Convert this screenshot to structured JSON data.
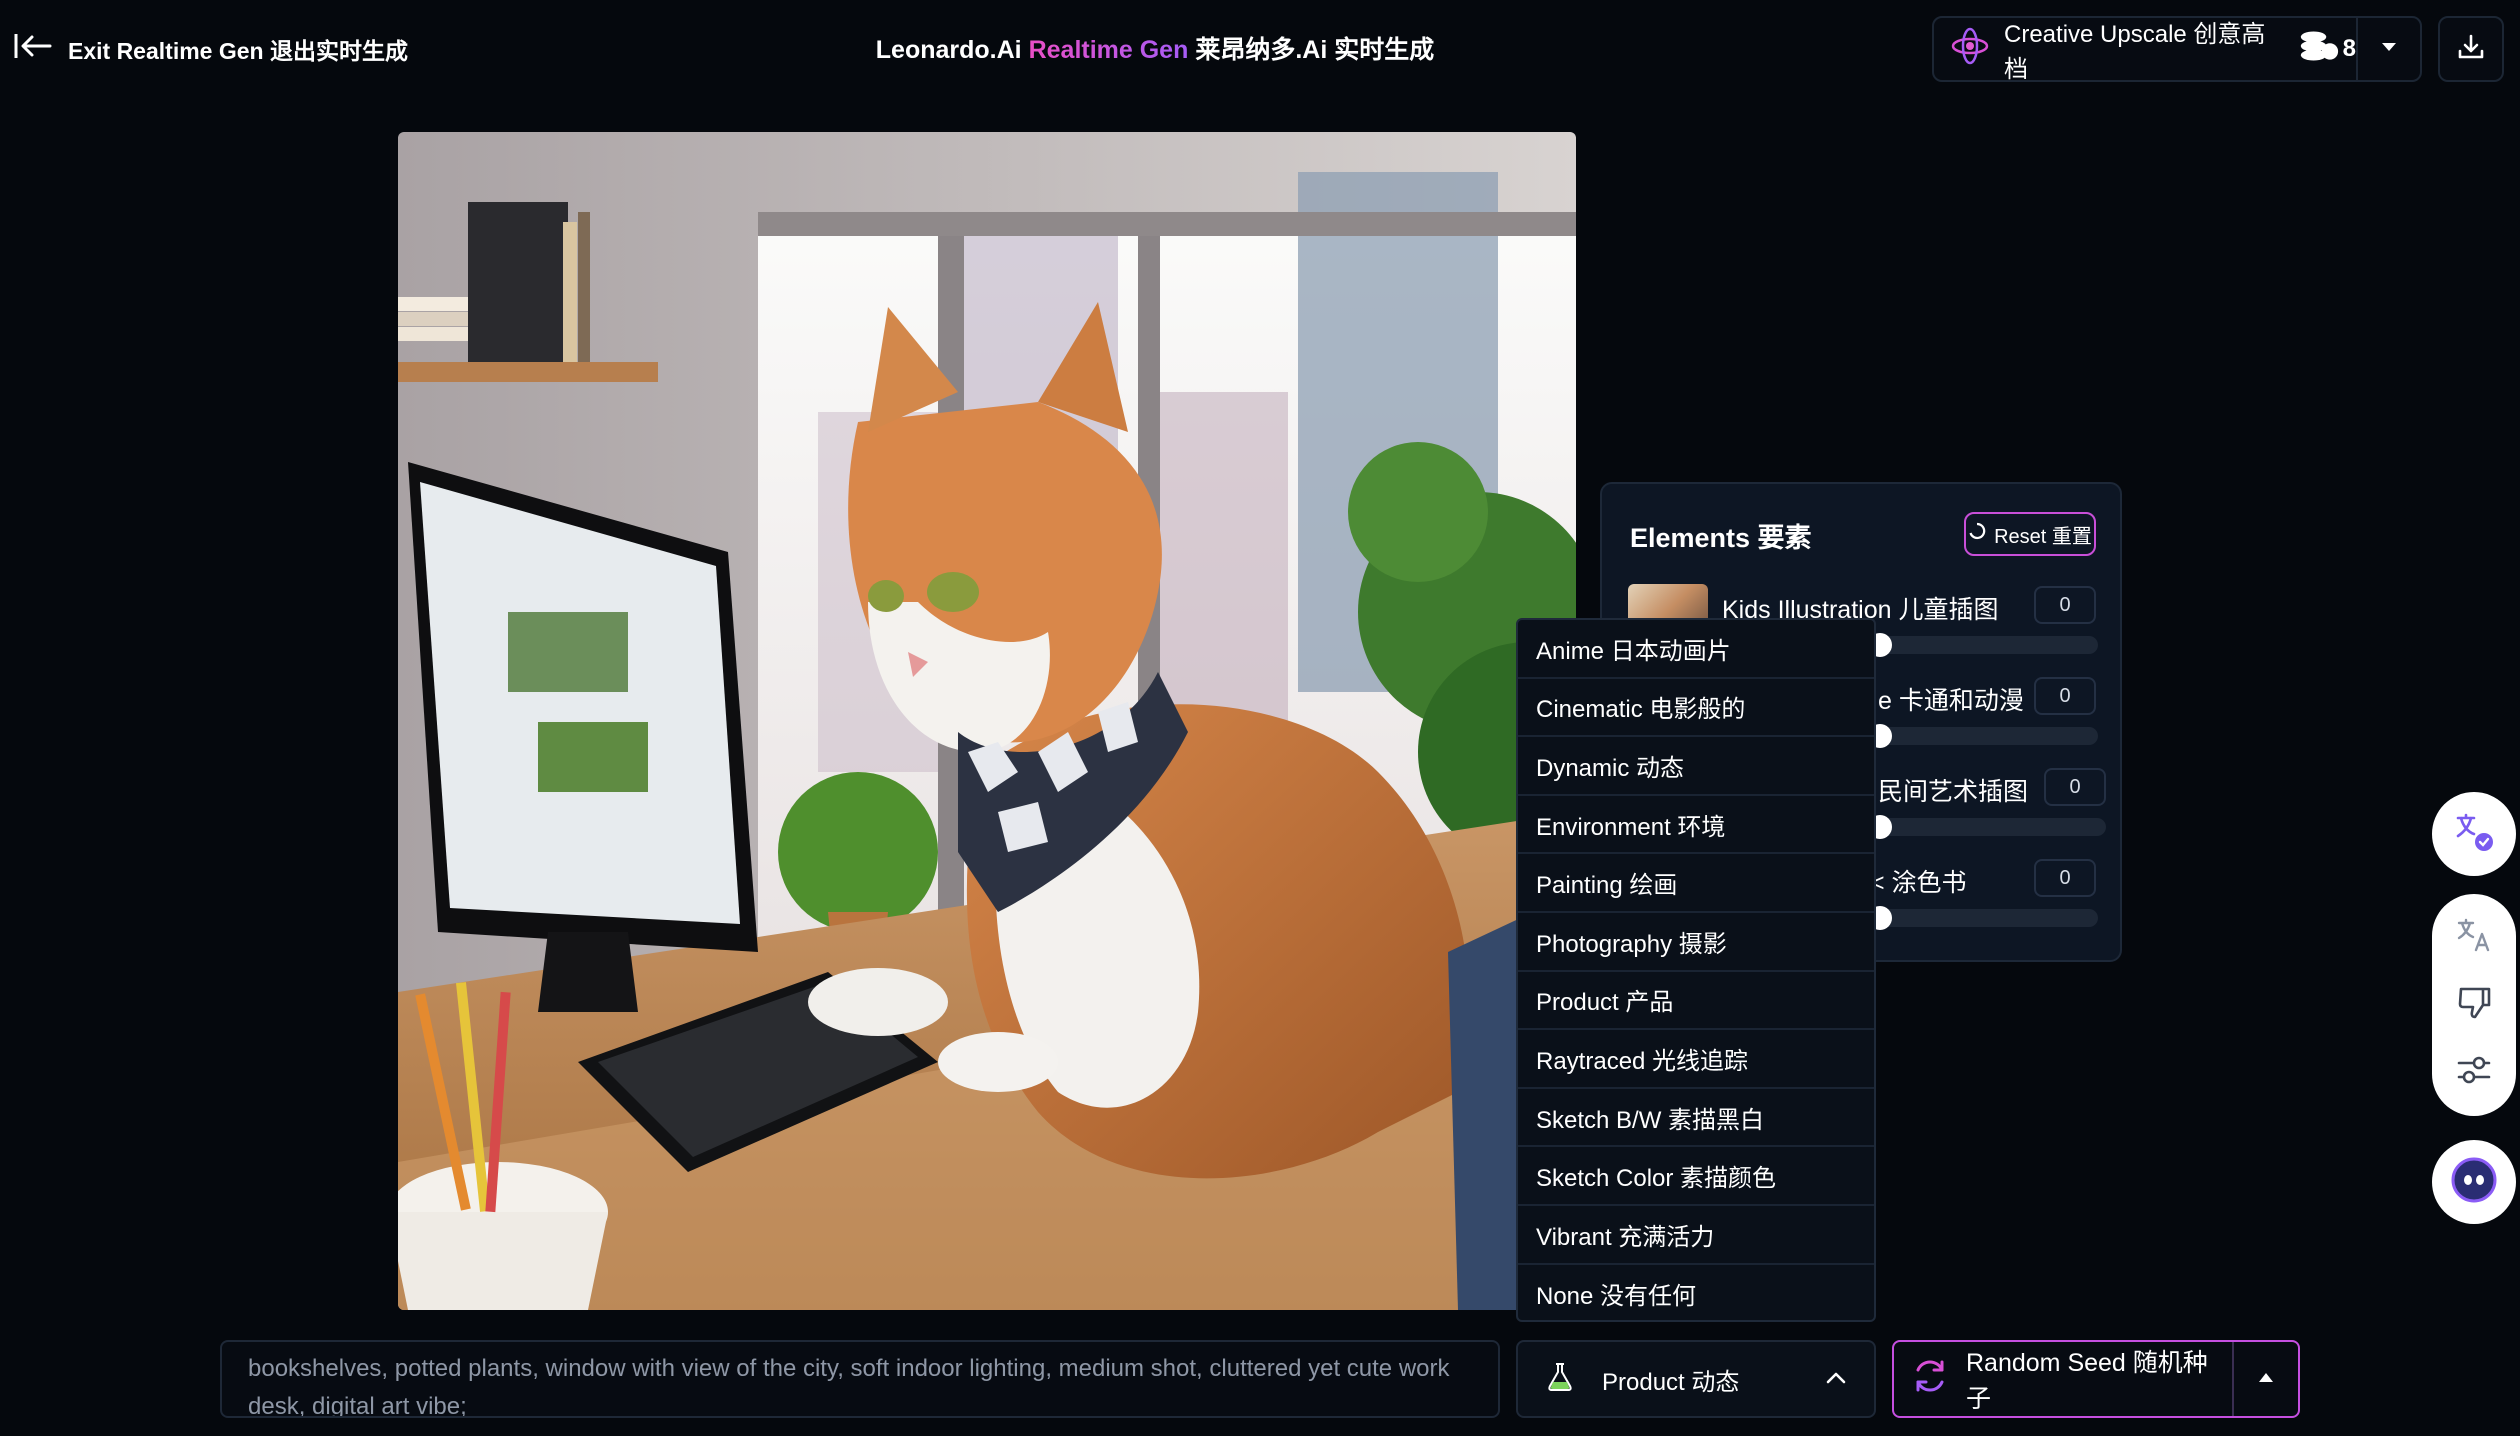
{
  "header": {
    "exit_label": "Exit Realtime Gen 退出实时生成",
    "title_brand": "Leonardo.Ai",
    "title_accent": "Realtime Gen",
    "title_cn": "莱昂纳多.Ai 实时生成",
    "upscale_label": "Creative Upscale 创意高档",
    "token_cost": "8"
  },
  "elements_panel": {
    "title": "Elements 要素",
    "reset_label": "Reset 重置",
    "items": [
      {
        "label": "Kids Illustration 儿童插图",
        "value": "0"
      },
      {
        "label": "e 卡通和动漫",
        "value": "0"
      },
      {
        "label": "民间艺术插图",
        "value": "0"
      },
      {
        "label": "< 涂色书",
        "value": "0"
      }
    ]
  },
  "style_menu": {
    "options": [
      "Anime 日本动画片",
      "Cinematic 电影般的",
      "Dynamic 动态",
      "Environment 环境",
      "Painting 绘画",
      "Photography 摄影",
      "Product 产品",
      "Raytraced 光线追踪",
      "Sketch B/W 素描黑白",
      "Sketch Color 素描颜色",
      "Vibrant 充满活力",
      "None 没有任何"
    ]
  },
  "prompt": {
    "text": "bookshelves, potted plants, window with view of the city, soft indoor lighting, medium shot, cluttered yet cute work desk, digital art vibe;"
  },
  "style_select": {
    "value": "Product 动态"
  },
  "seed": {
    "label": "Random Seed 随机种子"
  },
  "colors": {
    "background": "#05080d",
    "accent_pink": "#ea4fc6",
    "accent_purple": "#a65cf6",
    "panel": "#0d1624"
  },
  "icons": [
    "back-arrow-icon",
    "creative-upscale-icon",
    "token-icon",
    "chevron-down-icon",
    "download-icon",
    "reset-icon",
    "style-icon",
    "chevron-up-icon",
    "refresh-icon",
    "caret-up-icon",
    "translate-icon",
    "translate-alt-icon",
    "thumbs-down-icon",
    "sliders-icon",
    "assistant-icon"
  ]
}
